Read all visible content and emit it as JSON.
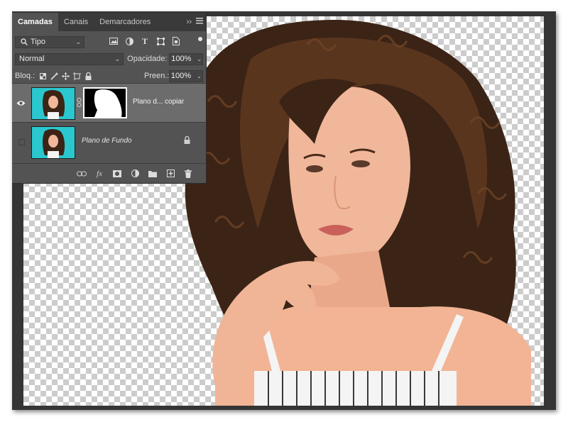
{
  "panel": {
    "tabs": [
      {
        "label": "Camadas",
        "active": true
      },
      {
        "label": "Canais",
        "active": false
      },
      {
        "label": "Demarcadores",
        "active": false
      }
    ],
    "tab_menu": "››",
    "filter_label": "Tipo",
    "blend_mode": "Normal",
    "opacity_label": "Opacidade:",
    "opacity_value": "100%",
    "lock_label": "Bloq.:",
    "fill_label": "Preen.:",
    "fill_value": "100%",
    "layers": [
      {
        "name": "Plano d... copiar",
        "visible": true,
        "selected": true,
        "has_mask": true
      },
      {
        "name": "Plano de Fundo",
        "visible": false,
        "selected": false,
        "locked": true
      }
    ],
    "icons": [
      "search-icon",
      "image-filter-icon",
      "adjustment-filter-icon",
      "type-filter-icon",
      "shape-filter-icon",
      "smart-object-filter-icon",
      "link-icon",
      "fx-icon",
      "add-mask-icon",
      "new-adjustment-icon",
      "new-group-icon",
      "new-layer-icon",
      "delete-icon"
    ]
  },
  "colors": {
    "panel_bg": "#535353",
    "selected_layer": "#6c6c6c",
    "thumb_bg": "#2bc7cf"
  }
}
